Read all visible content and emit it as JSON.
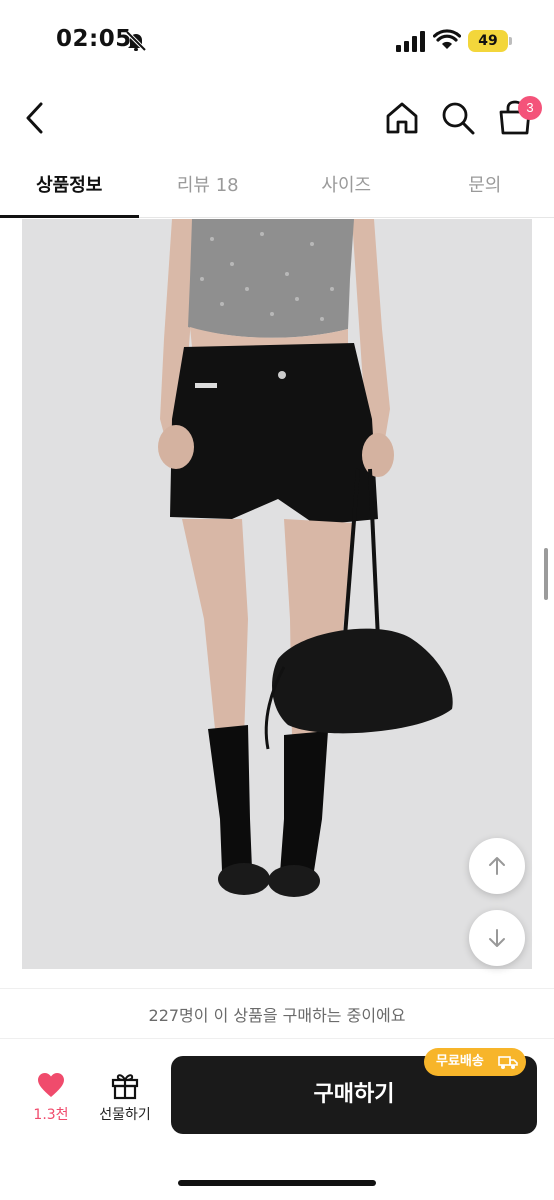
{
  "status_bar": {
    "time": "02:05",
    "battery": "49",
    "battery_color": "#f3d63b"
  },
  "nav": {
    "cart_count": "3",
    "badge_color": "#f4537a"
  },
  "tabs": [
    {
      "label": "상품정보",
      "active": true
    },
    {
      "label": "리뷰 18",
      "active": false
    },
    {
      "label": "사이즈",
      "active": false
    },
    {
      "label": "문의",
      "active": false
    }
  ],
  "product_image": {
    "icon": "product-photo-image",
    "background": "#e0e0e1"
  },
  "buyers_text": "227명이 이 상품을 구매하는 중이에요",
  "bottom_bar": {
    "like_count": "1.3천",
    "like_color": "#f04b6c",
    "gift_label": "선물하기",
    "buy_label": "구매하기",
    "shipping_badge": "무료배송",
    "shipping_color": "#f7b52a"
  }
}
